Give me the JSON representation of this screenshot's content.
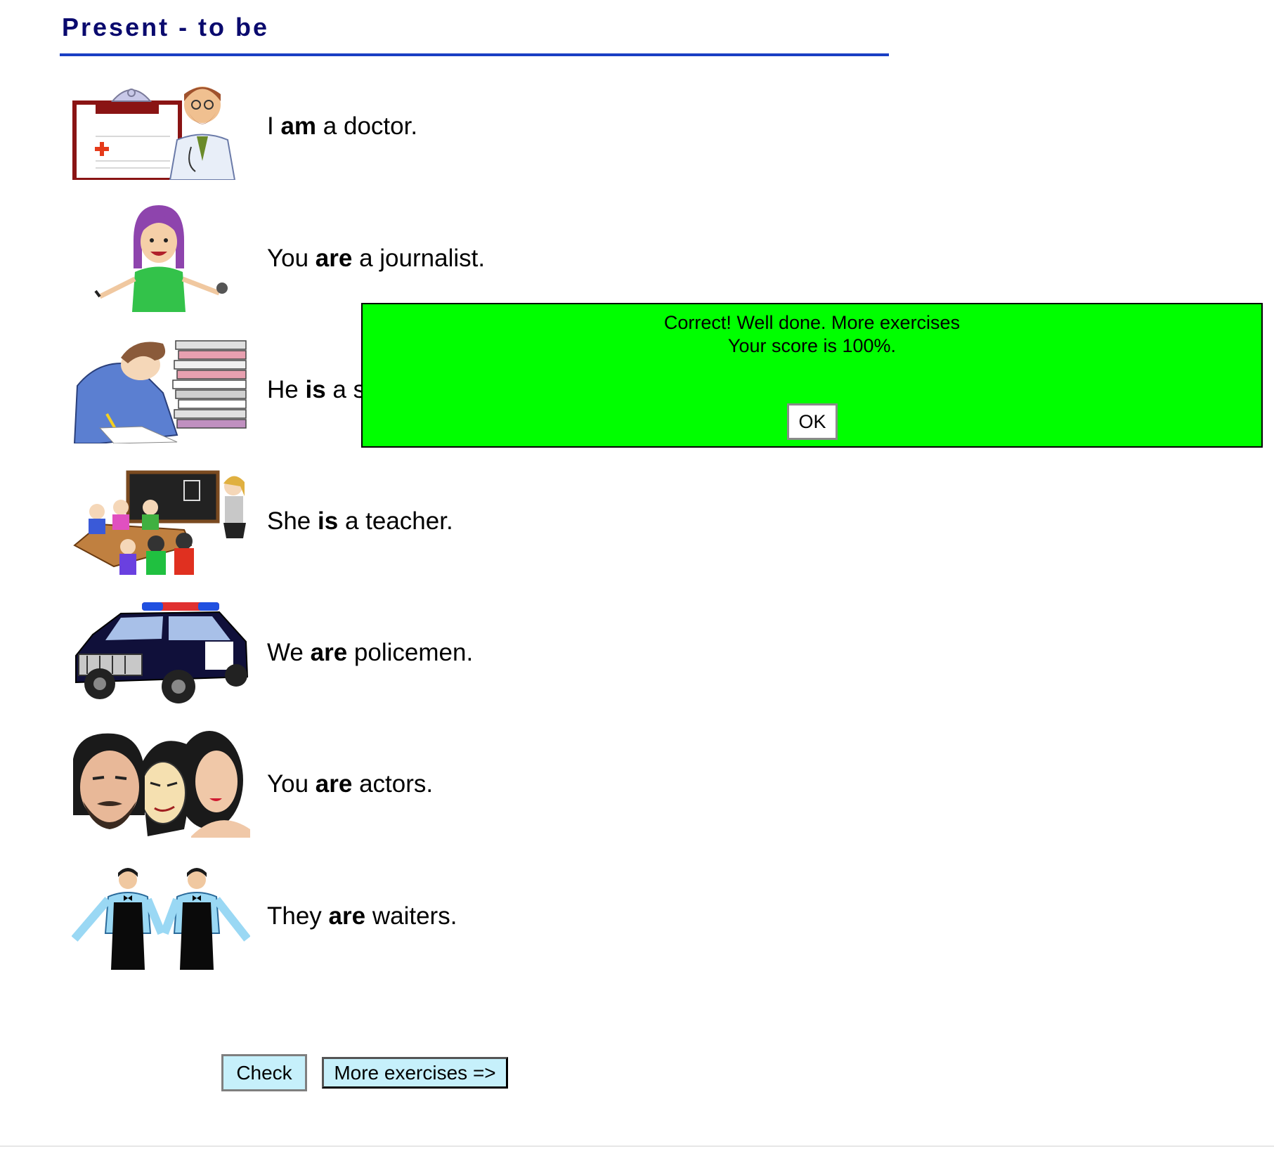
{
  "header": {
    "title": "Present - to be"
  },
  "sentences": [
    {
      "picture": "doctor-illustration",
      "subject": "I",
      "verb": "am",
      "rest": "a doctor."
    },
    {
      "picture": "journalist-illustration",
      "subject": "You",
      "verb": "are",
      "rest": "a journalist."
    },
    {
      "picture": "student-illustration",
      "subject": "He",
      "verb": "is",
      "rest": "a s"
    },
    {
      "picture": "teacher-classroom-illustration",
      "subject": "She",
      "verb": "is",
      "rest": "a teacher."
    },
    {
      "picture": "police-car-illustration",
      "subject": "We",
      "verb": "are",
      "rest": "policemen."
    },
    {
      "picture": "actors-faces-illustration",
      "subject": "You",
      "verb": "are",
      "rest": "actors."
    },
    {
      "picture": "waiters-illustration",
      "subject": "They",
      "verb": "are",
      "rest": "waiters."
    }
  ],
  "buttons": {
    "check": "Check",
    "more_exercises": "More exercises =>"
  },
  "feedback": {
    "line1": "Correct! Well done. More exercises",
    "line2": "Your score is 100%.",
    "ok": "OK",
    "background": "#00ff00"
  },
  "colors": {
    "title": "#0a0a6e",
    "title_rule": "#1a3fc4",
    "button_bg": "#c6f0fb"
  }
}
